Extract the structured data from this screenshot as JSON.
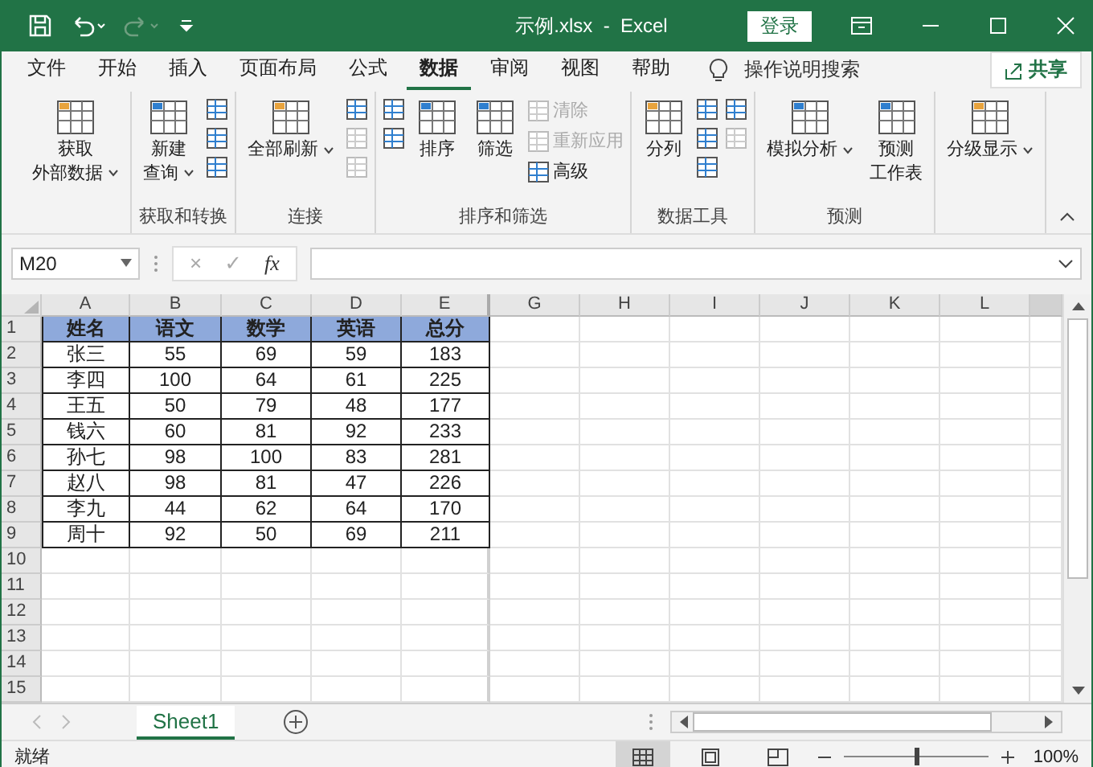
{
  "window": {
    "title": "示例.xlsx  -  Excel",
    "login": "登录"
  },
  "tabs": [
    {
      "label": "文件",
      "selected": false
    },
    {
      "label": "开始",
      "selected": false
    },
    {
      "label": "插入",
      "selected": false
    },
    {
      "label": "页面布局",
      "selected": false
    },
    {
      "label": "公式",
      "selected": false
    },
    {
      "label": "数据",
      "selected": true
    },
    {
      "label": "审阅",
      "selected": false
    },
    {
      "label": "视图",
      "selected": false
    },
    {
      "label": "帮助",
      "selected": false
    }
  ],
  "tell_me": "操作说明搜索",
  "share": "共享",
  "ribbon": [
    {
      "items": [
        {
          "kind": "large",
          "lines": [
            "获取",
            "外部数据"
          ],
          "dropdown": true
        }
      ]
    },
    {
      "label": "获取和转换",
      "items": [
        {
          "kind": "large",
          "lines": [
            "新建",
            "查询"
          ],
          "dropdown": true
        },
        {
          "kind": "stack",
          "items": [
            {
              "disabled": false
            },
            {
              "disabled": false
            },
            {
              "disabled": false
            }
          ]
        }
      ]
    },
    {
      "label": "连接",
      "items": [
        {
          "kind": "large",
          "lines": [
            "全部刷新"
          ],
          "dropdown": true
        },
        {
          "kind": "stack",
          "items": [
            {
              "disabled": false
            },
            {
              "disabled": true
            },
            {
              "disabled": true
            }
          ]
        }
      ]
    },
    {
      "label": "排序和筛选",
      "items": [
        {
          "kind": "stack",
          "items": [
            {
              "disabled": false
            },
            {
              "disabled": false
            }
          ]
        },
        {
          "kind": "large",
          "lines": [
            "排序"
          ],
          "dropdown": false
        },
        {
          "kind": "large",
          "lines": [
            "筛选"
          ],
          "dropdown": false
        },
        {
          "kind": "stack",
          "items": [
            {
              "label": "清除",
              "disabled": true
            },
            {
              "label": "重新应用",
              "disabled": true
            },
            {
              "label": "高级",
              "disabled": false
            }
          ]
        }
      ]
    },
    {
      "label": "数据工具",
      "items": [
        {
          "kind": "large",
          "lines": [
            "分列"
          ],
          "dropdown": false
        },
        {
          "kind": "stack",
          "items": [
            {
              "disabled": false
            },
            {
              "disabled": false
            },
            {
              "disabled": false
            }
          ]
        },
        {
          "kind": "stack",
          "items": [
            {
              "disabled": false
            },
            {
              "disabled": true
            }
          ]
        }
      ]
    },
    {
      "label": "预测",
      "items": [
        {
          "kind": "large",
          "lines": [
            "模拟分析"
          ],
          "dropdown": true
        },
        {
          "kind": "large",
          "lines": [
            "预测",
            "工作表"
          ],
          "dropdown": false
        }
      ]
    },
    {
      "items": [
        {
          "kind": "large",
          "lines": [
            "分级显示"
          ],
          "dropdown": true
        }
      ]
    }
  ],
  "formula_bar": {
    "name_box": "M20",
    "cancel": "×",
    "enter": "✓",
    "function": "fx"
  },
  "grid": {
    "columns": [
      "A",
      "B",
      "C",
      "D",
      "E",
      "G",
      "H",
      "I",
      "J",
      "K",
      "L"
    ],
    "rows": [
      {
        "number": "1",
        "cells": [
          "姓名",
          "语文",
          "数学",
          "英语",
          "总分"
        ]
      },
      {
        "number": "2",
        "cells": [
          "张三",
          "55",
          "69",
          "59",
          "183"
        ]
      },
      {
        "number": "3",
        "cells": [
          "李四",
          "100",
          "64",
          "61",
          "225"
        ]
      },
      {
        "number": "4",
        "cells": [
          "王五",
          "50",
          "79",
          "48",
          "177"
        ]
      },
      {
        "number": "5",
        "cells": [
          "钱六",
          "60",
          "81",
          "92",
          "233"
        ]
      },
      {
        "number": "6",
        "cells": [
          "孙七",
          "98",
          "100",
          "83",
          "281"
        ]
      },
      {
        "number": "7",
        "cells": [
          "赵八",
          "98",
          "81",
          "47",
          "226"
        ]
      },
      {
        "number": "8",
        "cells": [
          "李九",
          "44",
          "62",
          "64",
          "170"
        ]
      },
      {
        "number": "9",
        "cells": [
          "周十",
          "92",
          "50",
          "69",
          "211"
        ]
      },
      {
        "number": "10"
      },
      {
        "number": "11"
      },
      {
        "number": "12"
      },
      {
        "number": "13"
      },
      {
        "number": "14"
      },
      {
        "number": "15"
      }
    ]
  },
  "sheets": [
    {
      "label": "Sheet1",
      "selected": true
    }
  ],
  "status_bar": {
    "status": "就绪",
    "views": [
      {
        "kind": "normal",
        "selected": true
      },
      {
        "kind": "layout",
        "selected": false
      },
      {
        "kind": "break",
        "selected": false
      }
    ],
    "zoom": {
      "level": 0.5,
      "reading": "100%"
    }
  }
}
